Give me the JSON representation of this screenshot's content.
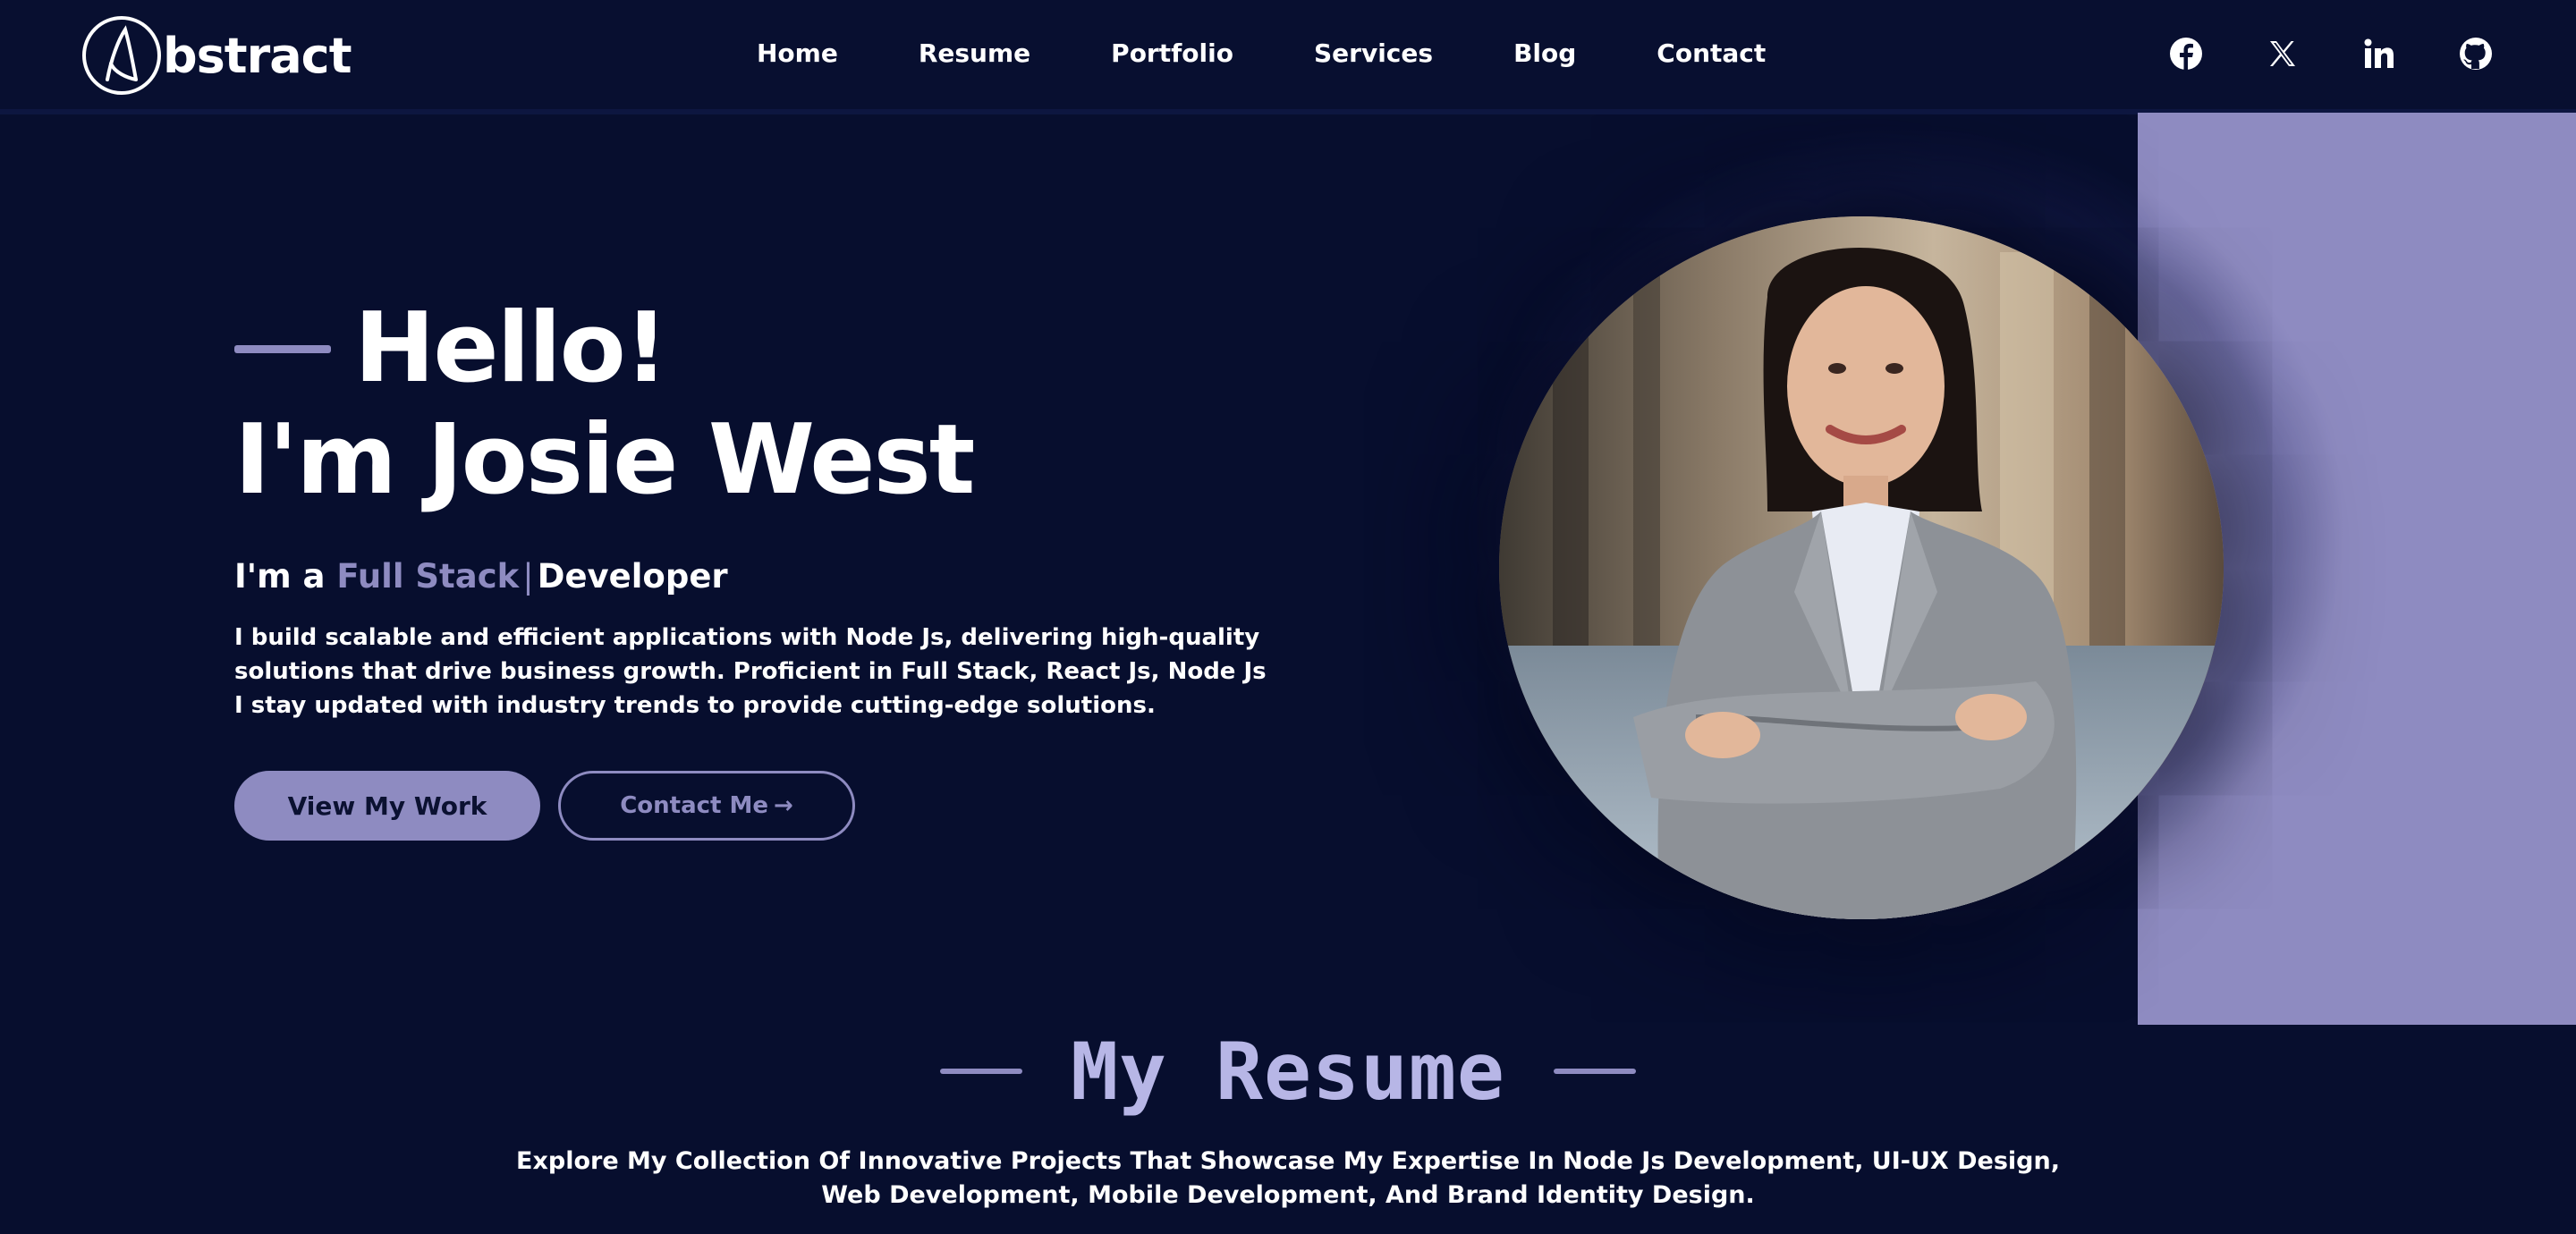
{
  "brand": {
    "name": "Abstract",
    "logo_letter": "A",
    "logo_rest": "bstract"
  },
  "nav": {
    "items": [
      {
        "label": "Home"
      },
      {
        "label": "Resume"
      },
      {
        "label": "Portfolio"
      },
      {
        "label": "Services"
      },
      {
        "label": "Blog"
      },
      {
        "label": "Contact"
      }
    ]
  },
  "socials": [
    {
      "icon": "facebook-icon"
    },
    {
      "icon": "x-twitter-icon"
    },
    {
      "icon": "linkedin-icon"
    },
    {
      "icon": "github-icon"
    }
  ],
  "hero": {
    "greeting": "Hello!",
    "name_line": "I'm Josie West",
    "role_prefix": "I'm a ",
    "role_accent": "Full Stack",
    "role_cursor": "|",
    "role_suffix": "Developer",
    "description": "I build scalable and efficient applications with Node Js, delivering high-quality solutions that drive business growth. Proficient in Full Stack, React Js, Node Js I stay updated with industry trends to provide cutting-edge solutions.",
    "primary_button": "View My Work",
    "secondary_button": "Contact Me",
    "secondary_arrow": "→"
  },
  "resume": {
    "title": "My Resume",
    "description": "Explore My Collection Of Innovative Projects That Showcase My Expertise In Node Js Development, UI-UX Design, Web Development, Mobile Development, And Brand Identity Design."
  },
  "colors": {
    "background": "#070e2e",
    "accent": "#8e8bc1",
    "resume_title": "#b7b6e6"
  }
}
